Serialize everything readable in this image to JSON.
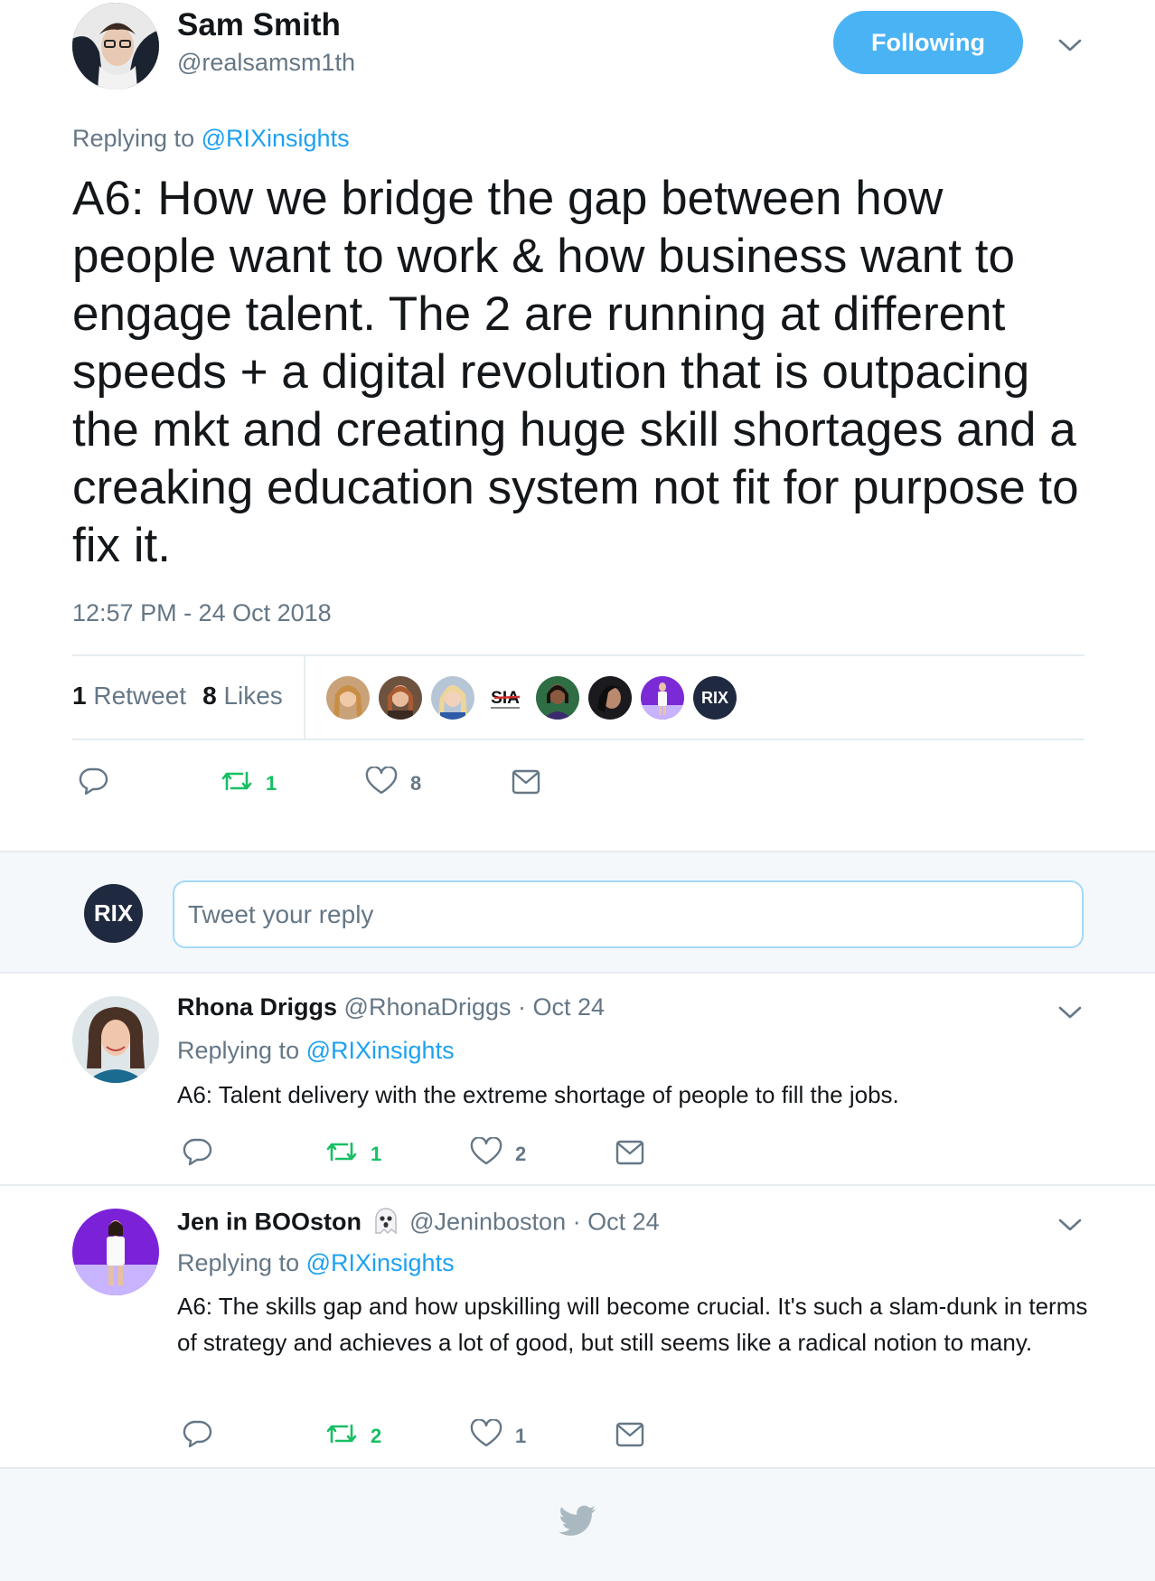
{
  "main_tweet": {
    "author_name": "Sam Smith",
    "author_handle": "@realsamsm1th",
    "follow_label": "Following",
    "replying_prefix": "Replying to",
    "replying_to": "@RIXinsights",
    "text": "A6: How we bridge the gap between how people want to work & how business want to engage talent. The 2 are running at different speeds + a digital revolution that is outpacing the mkt and creating huge skill shortages and a creaking education system not fit for purpose to fix it.",
    "timestamp": "12:57 PM - 24 Oct 2018",
    "retweet_count": "1",
    "retweet_label": "Retweet",
    "like_count": "8",
    "like_label": "Likes",
    "action_retweet_count": "1",
    "action_like_count": "8",
    "liker_avatar_texts": [
      "SIA",
      "RIX"
    ]
  },
  "reply_box": {
    "avatar_text": "RIX",
    "placeholder": "Tweet your reply"
  },
  "replies": [
    {
      "name": "Rhona Driggs",
      "handle": "@RhonaDriggs",
      "date": "· Oct 24",
      "replying_prefix": "Replying to",
      "replying_to": "@RIXinsights",
      "text": "A6:  Talent delivery with the extreme shortage of people to fill the jobs.",
      "retweets": "1",
      "likes": "2"
    },
    {
      "name": "Jen in BOOston",
      "handle": "@Jeninboston",
      "date": "· Oct 24",
      "replying_prefix": "Replying to",
      "replying_to": "@RIXinsights",
      "text": "A6: The skills gap and how upskilling will become crucial. It's such a slam-dunk in terms of strategy and achieves a lot of good, but still seems like a radical notion to many.",
      "retweets": "2",
      "likes": "1"
    }
  ],
  "colors": {
    "accent": "#1da1f2",
    "follow_button": "#4ab3f4",
    "retweet_green": "#17bf63",
    "secondary_text": "#657786",
    "divider": "#e6ecf0",
    "footer_bg": "#f5f8fa",
    "rix_avatar": "#1f2940"
  }
}
